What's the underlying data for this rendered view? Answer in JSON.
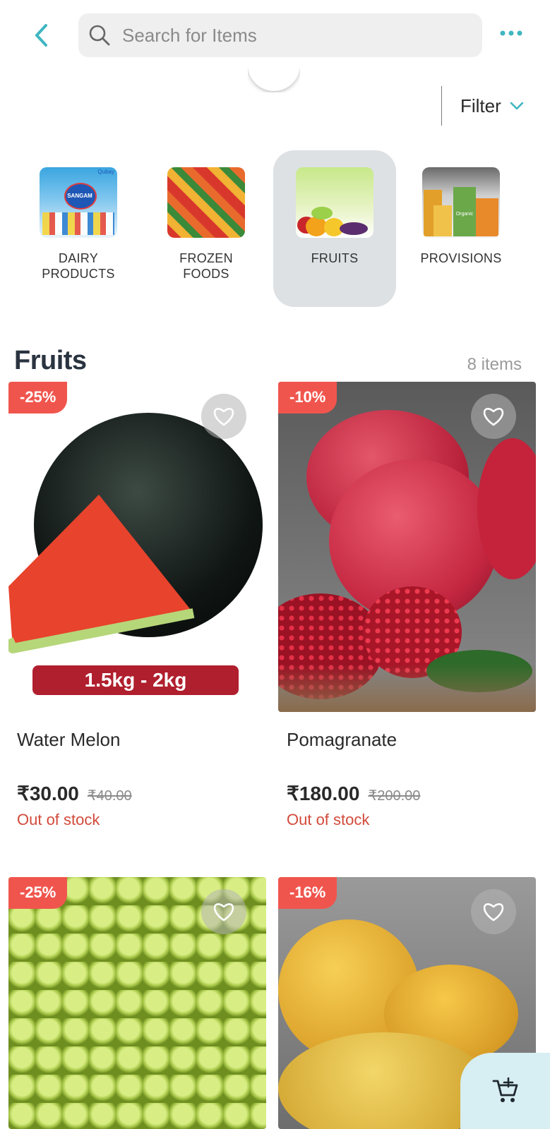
{
  "header": {
    "search_placeholder": "Search for Items",
    "filter_label": "Filter"
  },
  "categories": [
    {
      "label": "DAIRY\nPRODUCTS",
      "active": false
    },
    {
      "label": "FROZEN\nFOODS",
      "active": false
    },
    {
      "label": "FRUITS",
      "active": true
    },
    {
      "label": "PROVISIONS",
      "active": false
    }
  ],
  "category_thumbnail_text": {
    "dairy_brand_small": "Qubay",
    "dairy_brand_main": "SANGAM",
    "provisions_label": "Organic"
  },
  "section": {
    "title": "Fruits",
    "count": "8 items"
  },
  "products": [
    {
      "name": "Water Melon",
      "discount": "-25%",
      "price": "₹30.00",
      "mrp": "₹40.00",
      "stock": "Out of stock",
      "image_label": "1.5kg - 2kg"
    },
    {
      "name": "Pomagranate",
      "discount": "-10%",
      "price": "₹180.00",
      "mrp": "₹200.00",
      "stock": "Out of stock"
    },
    {
      "discount": "-25%"
    },
    {
      "discount": "-16%"
    }
  ],
  "colors": {
    "accent": "#3fb6c0",
    "discount_badge": "#f0554d",
    "out_of_stock": "#d24a3a",
    "active_category_bg": "#dde1e4"
  },
  "icons": [
    "back-arrow-icon",
    "search-icon",
    "more-dots-icon",
    "chevron-down-icon",
    "heart-icon",
    "add-to-cart-icon"
  ]
}
